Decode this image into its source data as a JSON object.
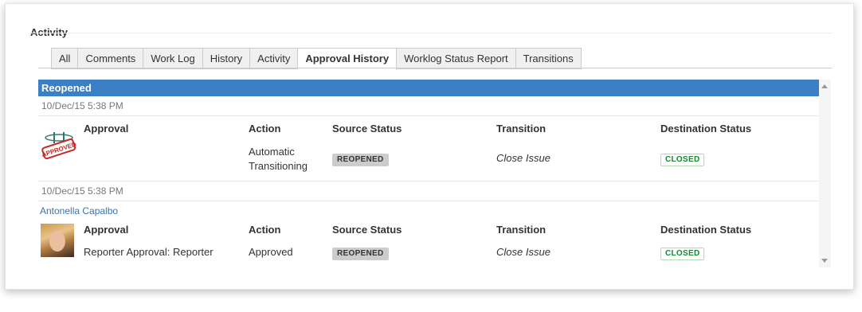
{
  "section": {
    "title": "Activity"
  },
  "tabs": [
    {
      "label": "All",
      "active": false
    },
    {
      "label": "Comments",
      "active": false
    },
    {
      "label": "Work Log",
      "active": false
    },
    {
      "label": "History",
      "active": false
    },
    {
      "label": "Activity",
      "active": false
    },
    {
      "label": "Approval History",
      "active": true
    },
    {
      "label": "Worklog Status Report",
      "active": false
    },
    {
      "label": "Transitions",
      "active": false
    }
  ],
  "columns": {
    "approval": "Approval",
    "action": "Action",
    "source": "Source Status",
    "transition": "Transition",
    "destination": "Destination Status"
  },
  "group": {
    "title": "Reopened",
    "color": "#3b7fc4"
  },
  "entries": [
    {
      "date": "10/Dec/15 5:38 PM",
      "author": "",
      "icon": "approved-stamp-icon",
      "approval": "",
      "action_line1": "Automatic",
      "action_line2": "Transitioning",
      "source_status": "REOPENED",
      "transition": "Close Issue",
      "destination_status": "CLOSED"
    },
    {
      "date": "10/Dec/15 5:38 PM",
      "author": "Antonella Capalbo",
      "icon": "user-avatar",
      "approval": "Reporter Approval: Reporter",
      "action": "Approved",
      "source_status": "REOPENED",
      "transition": "Close Issue",
      "destination_status": "CLOSED"
    }
  ],
  "stamp_text": "APPROVED",
  "colors": {
    "link": "#3b73af",
    "closed": "#14892c"
  }
}
